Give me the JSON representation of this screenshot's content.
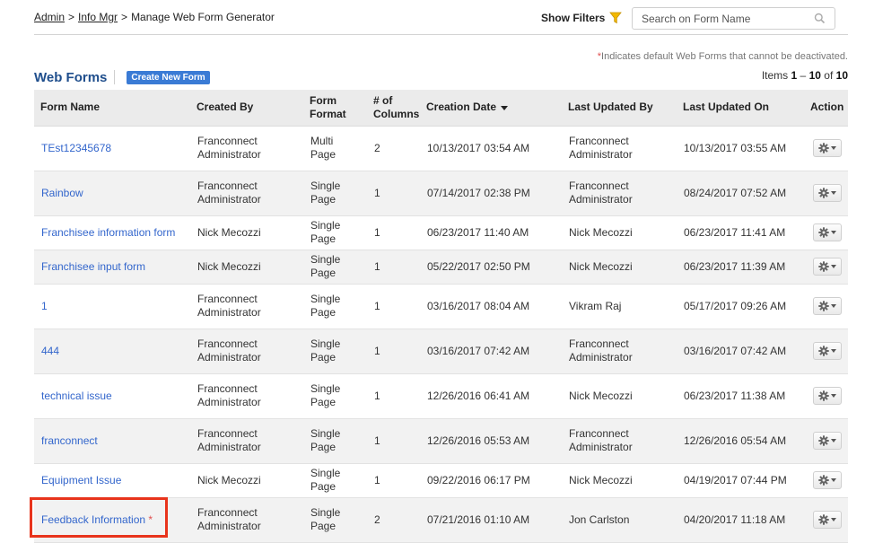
{
  "breadcrumb": {
    "items": [
      "Admin",
      "Info Mgr"
    ],
    "separator": ">",
    "current": "Manage Web Form Generator"
  },
  "filters": {
    "label": "Show Filters",
    "icon": "funnel-icon"
  },
  "search": {
    "placeholder": "Search on Form Name",
    "value": "",
    "icon": "search-icon"
  },
  "note": {
    "star": "*",
    "text": "Indicates default Web Forms that cannot be deactivated."
  },
  "items_count": {
    "prefix": "Items",
    "from": "1",
    "dash": "–",
    "to": "10",
    "of": "of",
    "total": "10"
  },
  "title": "Web Forms",
  "create_button": "Create New Form",
  "table": {
    "headers": {
      "form_name": "Form Name",
      "created_by": "Created By",
      "form_format": "Form Format",
      "columns": "# of Columns",
      "creation_date": "Creation Date",
      "last_updated_by": "Last Updated By",
      "last_updated_on": "Last Updated On",
      "action": "Action"
    },
    "rows": [
      {
        "name": "TEst12345678",
        "created_by": "Franconnect Administrator",
        "format": "Multi Page",
        "columns": "2",
        "created": "10/13/2017 03:54 AM",
        "updated_by": "Franconnect Administrator",
        "updated_on": "10/13/2017 03:55 AM",
        "star": ""
      },
      {
        "name": "Rainbow",
        "created_by": "Franconnect Administrator",
        "format": "Single Page",
        "columns": "1",
        "created": "07/14/2017 02:38 PM",
        "updated_by": "Franconnect Administrator",
        "updated_on": "08/24/2017 07:52 AM",
        "star": ""
      },
      {
        "name": "Franchisee information form",
        "created_by": "Nick Mecozzi",
        "format": "Single Page",
        "columns": "1",
        "created": "06/23/2017 11:40 AM",
        "updated_by": "Nick Mecozzi",
        "updated_on": "06/23/2017 11:41 AM",
        "star": ""
      },
      {
        "name": "Franchisee input form",
        "created_by": "Nick Mecozzi",
        "format": "Single Page",
        "columns": "1",
        "created": "05/22/2017 02:50 PM",
        "updated_by": "Nick Mecozzi",
        "updated_on": "06/23/2017 11:39 AM",
        "star": ""
      },
      {
        "name": "1",
        "created_by": "Franconnect Administrator",
        "format": "Single Page",
        "columns": "1",
        "created": "03/16/2017 08:04 AM",
        "updated_by": "Vikram Raj",
        "updated_on": "05/17/2017 09:26 AM",
        "star": ""
      },
      {
        "name": "444",
        "created_by": "Franconnect Administrator",
        "format": "Single Page",
        "columns": "1",
        "created": "03/16/2017 07:42 AM",
        "updated_by": "Franconnect Administrator",
        "updated_on": "03/16/2017 07:42 AM",
        "star": ""
      },
      {
        "name": "technical issue",
        "created_by": "Franconnect Administrator",
        "format": "Single Page",
        "columns": "1",
        "created": "12/26/2016 06:41 AM",
        "updated_by": "Nick Mecozzi",
        "updated_on": "06/23/2017 11:38 AM",
        "star": ""
      },
      {
        "name": "franconnect",
        "created_by": "Franconnect Administrator",
        "format": "Single Page",
        "columns": "1",
        "created": "12/26/2016 05:53 AM",
        "updated_by": "Franconnect Administrator",
        "updated_on": "12/26/2016 05:54 AM",
        "star": ""
      },
      {
        "name": "Equipment Issue",
        "created_by": "Nick Mecozzi",
        "format": "Single Page",
        "columns": "1",
        "created": "09/22/2016 06:17 PM",
        "updated_by": "Nick Mecozzi",
        "updated_on": "04/19/2017 07:44 PM",
        "star": ""
      },
      {
        "name": "Feedback Information",
        "created_by": "Franconnect Administrator",
        "format": "Single Page",
        "columns": "2",
        "created": "07/21/2016 01:10 AM",
        "updated_by": "Jon Carlston",
        "updated_on": "04/20/2017 11:18 AM",
        "star": "*"
      }
    ]
  },
  "colors": {
    "link": "#3366cc",
    "title": "#1f4e8c",
    "button": "#3a7bd5",
    "header_bg": "#ebebeb",
    "alt_row": "#f2f2f2",
    "highlight": "#e8341c",
    "filter_icon": "#f2b800"
  }
}
